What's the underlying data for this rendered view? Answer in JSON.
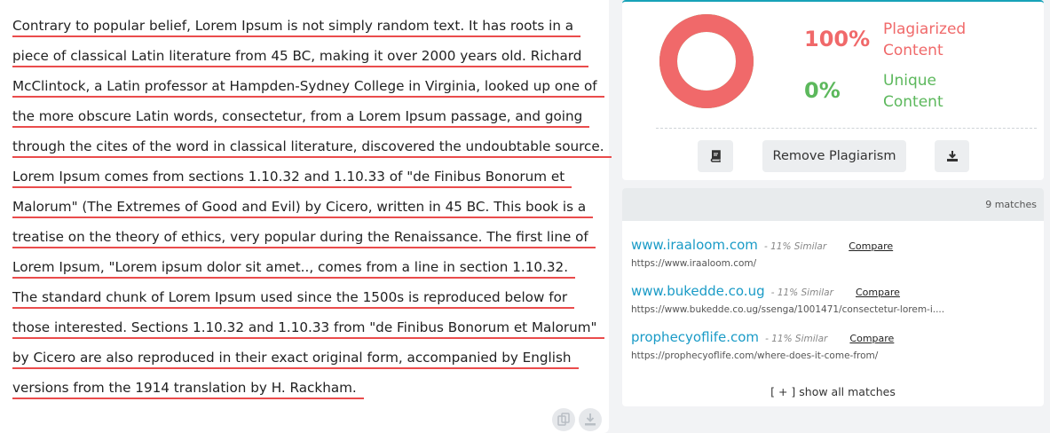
{
  "text_lines": [
    "Contrary to popular belief, Lorem Ipsum is not simply random text. It has roots in a",
    "piece of classical Latin literature from 45 BC, making it over 2000 years old. Richard",
    "McClintock, a Latin professor at Hampden-Sydney College in Virginia, looked up one of",
    "the more obscure Latin words, consectetur, from a Lorem Ipsum passage, and going",
    "through the cites of the word in classical literature, discovered the undoubtable source.",
    "Lorem Ipsum comes from sections 1.10.32 and 1.10.33 of \"de Finibus Bonorum et",
    "Malorum\" (The Extremes of Good and Evil) by Cicero, written in 45 BC. This book is a",
    "treatise on the theory of ethics, very popular during the Renaissance. The first line of",
    "Lorem Ipsum, \"Lorem ipsum dolor sit amet.., comes from a line in section 1.10.32.",
    "The standard chunk of Lorem Ipsum used since the 1500s is reproduced below for",
    "those interested. Sections 1.10.32 and 1.10.33 from \"de Finibus Bonorum et Malorum\"",
    "by Cicero are also reproduced in their exact original form, accompanied by English",
    "versions from the 1914 translation by H. Rackham."
  ],
  "result": {
    "plagiarized_pct": "100%",
    "plagiarized_label_1": "Plagiarized",
    "plagiarized_label_2": "Content",
    "unique_pct": "0%",
    "unique_label_1": "Unique",
    "unique_label_2": "Content",
    "plagiarized_fraction": 1.0,
    "remove_button": "Remove Plagiarism",
    "colors": {
      "plagiarized": "#f0696a",
      "unique": "#5cb85c"
    }
  },
  "matches": {
    "count_label": "9 matches",
    "compare_label": "Compare",
    "show_all": "[ + ] show all matches",
    "items": [
      {
        "domain": "www.iraaloom.com",
        "similarity": "- 11% Similar",
        "url": "https://www.iraaloom.com/"
      },
      {
        "domain": "www.bukedde.co.ug",
        "similarity": "- 11% Similar",
        "url": "https://www.bukedde.co.ug/ssenga/1001471/consectetur-lorem-i...."
      },
      {
        "domain": "prophecyoflife.com",
        "similarity": "- 11% Similar",
        "url": "https://prophecyoflife.com/where-does-it-come-from/"
      }
    ]
  },
  "icons": {
    "report": "book-icon",
    "download": "download-icon",
    "copy": "copy-icon"
  }
}
